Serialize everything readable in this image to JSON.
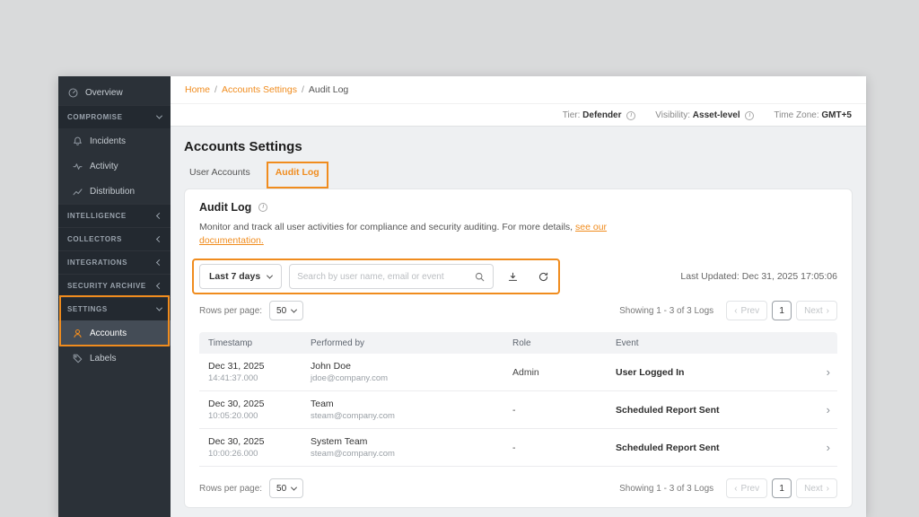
{
  "colors": {
    "accent": "#f08c1e",
    "sidebar-bg": "#2b3138",
    "sidebar-section-bg": "#232930"
  },
  "sidebar": {
    "items": [
      {
        "label": "Overview"
      },
      {
        "label": "COMPROMISE"
      },
      {
        "label": "Incidents"
      },
      {
        "label": "Activity"
      },
      {
        "label": "Distribution"
      },
      {
        "label": "INTELLIGENCE"
      },
      {
        "label": "COLLECTORS"
      },
      {
        "label": "INTEGRATIONS"
      },
      {
        "label": "SECURITY ARCHIVE"
      },
      {
        "label": "SETTINGS"
      },
      {
        "label": "Accounts"
      },
      {
        "label": "Labels"
      }
    ]
  },
  "breadcrumb": {
    "separator": "/",
    "items": [
      "Home",
      "Accounts Settings",
      "Audit Log"
    ]
  },
  "info_bar": {
    "tier_label": "Tier:",
    "tier_value": "Defender",
    "visibility_label": "Visibility:",
    "visibility_value": "Asset-level",
    "timezone_label": "Time Zone:",
    "timezone_value": "GMT+5"
  },
  "page": {
    "title": "Accounts Settings"
  },
  "tabs": [
    {
      "label": "User Accounts"
    },
    {
      "label": "Audit Log"
    }
  ],
  "card": {
    "title": "Audit Log",
    "description": "Monitor and track all user activities for compliance and security auditing. For more details,",
    "description_link": "see our documentation.",
    "filters": {
      "range_label": "Last 7 days",
      "search_placeholder": "Search by user name, email or event"
    },
    "last_updated_label": "Last Updated:",
    "last_updated_value": "Dec 31, 2025 17:05:06",
    "rows_per_page_label": "Rows per page:",
    "rows_per_page_value": "50",
    "showing_text": "Showing 1 - 3 of 3 Logs",
    "pagination": {
      "prev": "Prev",
      "page": "1",
      "next": "Next"
    }
  },
  "table": {
    "columns": [
      "Timestamp",
      "Performed by",
      "Role",
      "Event"
    ],
    "rows": [
      {
        "date": "Dec 31, 2025",
        "time": "14:41:37.000",
        "name": "John Doe",
        "email": "jdoe@company.com",
        "role": "Admin",
        "event": "User Logged In"
      },
      {
        "date": "Dec 30, 2025",
        "time": "10:05:20.000",
        "name": "Team",
        "email": "steam@company.com",
        "role": "-",
        "event": "Scheduled Report Sent"
      },
      {
        "date": "Dec 30, 2025",
        "time": "10:00:26.000",
        "name": "System Team",
        "email": "steam@company.com",
        "role": "-",
        "event": "Scheduled Report Sent"
      }
    ]
  }
}
